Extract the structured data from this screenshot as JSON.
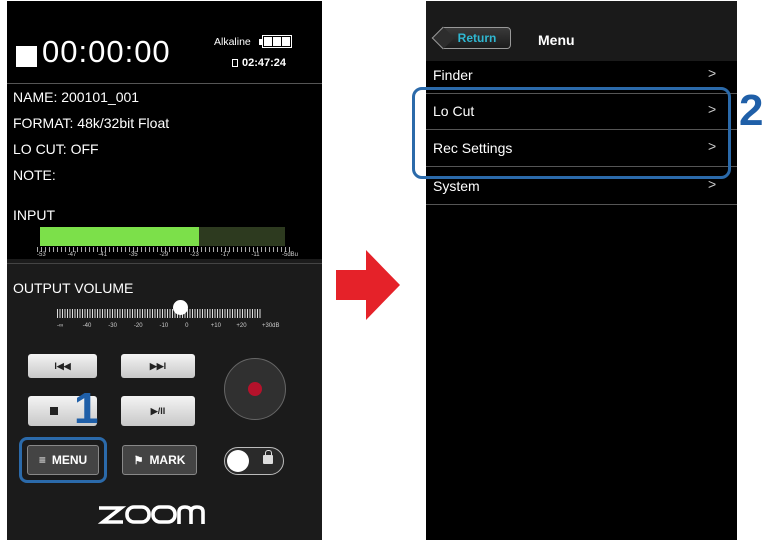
{
  "recorder": {
    "timecode": "00:00:00",
    "battery_label": "Alkaline",
    "remaining_time": "02:47:24",
    "name": "NAME: 200101_001",
    "format_label": "FORMAT:",
    "format_value": "48k/32bit Float",
    "locut": "LO CUT: OFF",
    "note": "NOTE:",
    "input_label": "INPUT",
    "input_level": 0.65,
    "input_scale": [
      "-53",
      "-47",
      "-41",
      "-35",
      "-29",
      "-23",
      "-17",
      "-11",
      "-5dBu"
    ],
    "output_label": "OUTPUT VOLUME",
    "output_level": 0.6,
    "output_scale": [
      "-∞",
      "-40",
      "-30",
      "-20",
      "-10",
      "0",
      "+10",
      "+20",
      "+30dB"
    ],
    "rew_icon": "skip-back-icon",
    "ff_icon": "skip-forward-icon",
    "stop_icon": "stop-icon",
    "play_label": "▶/II",
    "menu_label": "MENU",
    "mark_label": "MARK",
    "logo": "ZOOM"
  },
  "callouts": {
    "step1": "1",
    "step2": "2"
  },
  "menu_screen": {
    "return_label": "Return",
    "title": "Menu",
    "items": [
      {
        "label": "Finder"
      },
      {
        "label": "Lo Cut"
      },
      {
        "label": "Rec Settings"
      },
      {
        "label": "System"
      }
    ],
    "chevron": ">"
  },
  "colors": {
    "arrow": "#e52229",
    "callout": "#1f5fa8",
    "meter": "#7ce04a",
    "rec": "#b5122b",
    "return_text": "#2fb7d1"
  }
}
